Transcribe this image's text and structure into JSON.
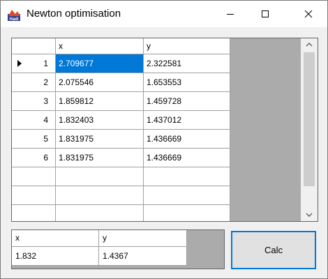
{
  "window": {
    "title": "Newton optimisation",
    "accent_color": "#0078d7"
  },
  "main_grid": {
    "columns": [
      "x",
      "y"
    ],
    "rows": [
      {
        "index": "1",
        "x": "2.709677",
        "y": "2.322581",
        "current": true
      },
      {
        "index": "2",
        "x": "2.075546",
        "y": "1.653553"
      },
      {
        "index": "3",
        "x": "1.859812",
        "y": "1.459728"
      },
      {
        "index": "4",
        "x": "1.832403",
        "y": "1.437012"
      },
      {
        "index": "5",
        "x": "1.831975",
        "y": "1.436669"
      },
      {
        "index": "6",
        "x": "1.831975",
        "y": "1.436669"
      },
      {
        "index": "",
        "x": "",
        "y": ""
      },
      {
        "index": "",
        "x": "",
        "y": ""
      },
      {
        "index": "",
        "x": "",
        "y": ""
      }
    ]
  },
  "result_grid": {
    "columns": [
      "x",
      "y"
    ],
    "values": {
      "x": "1.832",
      "y": "1.4367"
    }
  },
  "calc_button": {
    "label": "Calc"
  }
}
